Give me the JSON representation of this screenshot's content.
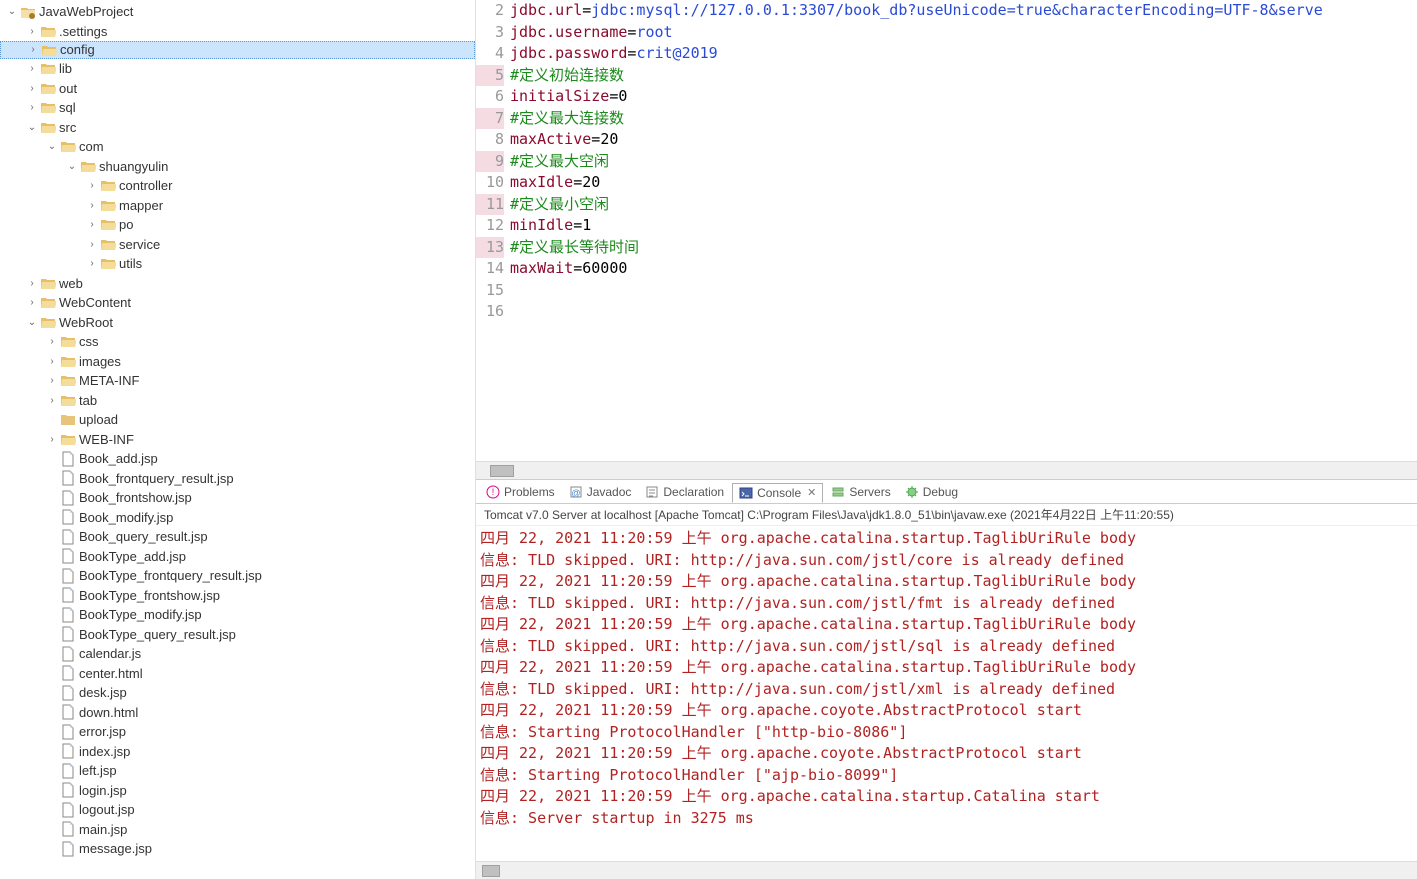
{
  "tree": {
    "root": "JavaWebProject",
    "items": [
      {
        "depth": 0,
        "arrow": "v",
        "icon": "project",
        "label": "JavaWebProject"
      },
      {
        "depth": 1,
        "arrow": ">",
        "icon": "folder-open",
        "label": ".settings"
      },
      {
        "depth": 1,
        "arrow": ">",
        "icon": "folder-open",
        "label": "config",
        "selected": true
      },
      {
        "depth": 1,
        "arrow": ">",
        "icon": "folder-open",
        "label": "lib"
      },
      {
        "depth": 1,
        "arrow": ">",
        "icon": "folder-open",
        "label": "out"
      },
      {
        "depth": 1,
        "arrow": ">",
        "icon": "folder-open",
        "label": "sql"
      },
      {
        "depth": 1,
        "arrow": "v",
        "icon": "folder-open",
        "label": "src"
      },
      {
        "depth": 2,
        "arrow": "v",
        "icon": "folder-open",
        "label": "com"
      },
      {
        "depth": 3,
        "arrow": "v",
        "icon": "folder-open",
        "label": "shuangyulin"
      },
      {
        "depth": 4,
        "arrow": ">",
        "icon": "folder-open",
        "label": "controller"
      },
      {
        "depth": 4,
        "arrow": ">",
        "icon": "folder-open",
        "label": "mapper"
      },
      {
        "depth": 4,
        "arrow": ">",
        "icon": "folder-open",
        "label": "po"
      },
      {
        "depth": 4,
        "arrow": ">",
        "icon": "folder-open",
        "label": "service"
      },
      {
        "depth": 4,
        "arrow": ">",
        "icon": "folder-open",
        "label": "utils"
      },
      {
        "depth": 1,
        "arrow": ">",
        "icon": "folder-open",
        "label": "web"
      },
      {
        "depth": 1,
        "arrow": ">",
        "icon": "folder-open",
        "label": "WebContent"
      },
      {
        "depth": 1,
        "arrow": "v",
        "icon": "folder-open",
        "label": "WebRoot"
      },
      {
        "depth": 2,
        "arrow": ">",
        "icon": "folder-open",
        "label": "css"
      },
      {
        "depth": 2,
        "arrow": ">",
        "icon": "folder-open",
        "label": "images"
      },
      {
        "depth": 2,
        "arrow": ">",
        "icon": "folder-open",
        "label": "META-INF"
      },
      {
        "depth": 2,
        "arrow": ">",
        "icon": "folder-open",
        "label": "tab"
      },
      {
        "depth": 2,
        "arrow": "",
        "icon": "folder-closed",
        "label": "upload"
      },
      {
        "depth": 2,
        "arrow": ">",
        "icon": "folder-open",
        "label": "WEB-INF"
      },
      {
        "depth": 2,
        "arrow": "",
        "icon": "file",
        "label": "Book_add.jsp"
      },
      {
        "depth": 2,
        "arrow": "",
        "icon": "file",
        "label": "Book_frontquery_result.jsp"
      },
      {
        "depth": 2,
        "arrow": "",
        "icon": "file",
        "label": "Book_frontshow.jsp"
      },
      {
        "depth": 2,
        "arrow": "",
        "icon": "file",
        "label": "Book_modify.jsp"
      },
      {
        "depth": 2,
        "arrow": "",
        "icon": "file",
        "label": "Book_query_result.jsp"
      },
      {
        "depth": 2,
        "arrow": "",
        "icon": "file",
        "label": "BookType_add.jsp"
      },
      {
        "depth": 2,
        "arrow": "",
        "icon": "file",
        "label": "BookType_frontquery_result.jsp"
      },
      {
        "depth": 2,
        "arrow": "",
        "icon": "file",
        "label": "BookType_frontshow.jsp"
      },
      {
        "depth": 2,
        "arrow": "",
        "icon": "file",
        "label": "BookType_modify.jsp"
      },
      {
        "depth": 2,
        "arrow": "",
        "icon": "file",
        "label": "BookType_query_result.jsp"
      },
      {
        "depth": 2,
        "arrow": "",
        "icon": "file",
        "label": "calendar.js"
      },
      {
        "depth": 2,
        "arrow": "",
        "icon": "file",
        "label": "center.html"
      },
      {
        "depth": 2,
        "arrow": "",
        "icon": "file",
        "label": "desk.jsp"
      },
      {
        "depth": 2,
        "arrow": "",
        "icon": "file",
        "label": "down.html"
      },
      {
        "depth": 2,
        "arrow": "",
        "icon": "file",
        "label": "error.jsp"
      },
      {
        "depth": 2,
        "arrow": "",
        "icon": "file",
        "label": "index.jsp"
      },
      {
        "depth": 2,
        "arrow": "",
        "icon": "file",
        "label": "left.jsp"
      },
      {
        "depth": 2,
        "arrow": "",
        "icon": "file",
        "label": "login.jsp"
      },
      {
        "depth": 2,
        "arrow": "",
        "icon": "file",
        "label": "logout.jsp"
      },
      {
        "depth": 2,
        "arrow": "",
        "icon": "file",
        "label": "main.jsp"
      },
      {
        "depth": 2,
        "arrow": "",
        "icon": "file",
        "label": "message.jsp"
      }
    ]
  },
  "editor": {
    "lines": [
      {
        "n": 2,
        "hl": false,
        "tokens": [
          [
            "key",
            "jdbc.url"
          ],
          [
            "eq",
            "="
          ],
          [
            "url",
            "jdbc:mysql://127.0.0.1:3307/book_db?useUnicode=true&characterEncoding=UTF-8&serve"
          ]
        ]
      },
      {
        "n": 3,
        "hl": false,
        "tokens": [
          [
            "key",
            "jdbc.username"
          ],
          [
            "eq",
            "="
          ],
          [
            "str",
            "root"
          ]
        ]
      },
      {
        "n": 4,
        "hl": false,
        "tokens": [
          [
            "key",
            "jdbc.password"
          ],
          [
            "eq",
            "="
          ],
          [
            "str",
            "crit@2019"
          ]
        ]
      },
      {
        "n": 5,
        "hl": true,
        "tokens": [
          [
            "comment",
            "#定义初始连接数"
          ]
        ]
      },
      {
        "n": 6,
        "hl": false,
        "tokens": [
          [
            "key",
            "initialSize"
          ],
          [
            "eq",
            "="
          ],
          [
            "num",
            "0"
          ]
        ]
      },
      {
        "n": 7,
        "hl": true,
        "tokens": [
          [
            "comment",
            "#定义最大连接数"
          ]
        ]
      },
      {
        "n": 8,
        "hl": false,
        "tokens": [
          [
            "key",
            "maxActive"
          ],
          [
            "eq",
            "="
          ],
          [
            "num",
            "20"
          ]
        ]
      },
      {
        "n": 9,
        "hl": true,
        "tokens": [
          [
            "comment",
            "#定义最大空闲"
          ]
        ]
      },
      {
        "n": 10,
        "hl": false,
        "tokens": [
          [
            "key",
            "maxIdle"
          ],
          [
            "eq",
            "="
          ],
          [
            "num",
            "20"
          ]
        ]
      },
      {
        "n": 11,
        "hl": true,
        "tokens": [
          [
            "comment",
            "#定义最小空闲"
          ]
        ]
      },
      {
        "n": 12,
        "hl": false,
        "tokens": [
          [
            "key",
            "minIdle"
          ],
          [
            "eq",
            "="
          ],
          [
            "num",
            "1"
          ]
        ]
      },
      {
        "n": 13,
        "hl": true,
        "tokens": [
          [
            "comment",
            "#定义最长等待时间"
          ]
        ]
      },
      {
        "n": 14,
        "hl": false,
        "tokens": [
          [
            "key",
            "maxWait"
          ],
          [
            "eq",
            "="
          ],
          [
            "num",
            "60000"
          ]
        ]
      },
      {
        "n": 15,
        "hl": false,
        "tokens": []
      },
      {
        "n": 16,
        "hl": false,
        "tokens": []
      }
    ]
  },
  "tabs": [
    {
      "label": "Problems",
      "icon": "problems",
      "active": false
    },
    {
      "label": "Javadoc",
      "icon": "javadoc",
      "active": false
    },
    {
      "label": "Declaration",
      "icon": "declaration",
      "active": false
    },
    {
      "label": "Console",
      "icon": "console",
      "active": true,
      "closable": true
    },
    {
      "label": "Servers",
      "icon": "servers",
      "active": false
    },
    {
      "label": "Debug",
      "icon": "debug",
      "active": false
    }
  ],
  "console": {
    "header": "Tomcat v7.0 Server at localhost [Apache Tomcat] C:\\Program Files\\Java\\jdk1.8.0_51\\bin\\javaw.exe (2021年4月22日 上午11:20:55)",
    "lines": [
      "四月 22, 2021 11:20:59 上午 org.apache.catalina.startup.TaglibUriRule body",
      "信息: TLD skipped. URI: http://java.sun.com/jstl/core is already defined",
      "四月 22, 2021 11:20:59 上午 org.apache.catalina.startup.TaglibUriRule body",
      "信息: TLD skipped. URI: http://java.sun.com/jstl/fmt is already defined",
      "四月 22, 2021 11:20:59 上午 org.apache.catalina.startup.TaglibUriRule body",
      "信息: TLD skipped. URI: http://java.sun.com/jstl/sql is already defined",
      "四月 22, 2021 11:20:59 上午 org.apache.catalina.startup.TaglibUriRule body",
      "信息: TLD skipped. URI: http://java.sun.com/jstl/xml is already defined",
      "四月 22, 2021 11:20:59 上午 org.apache.coyote.AbstractProtocol start",
      "信息: Starting ProtocolHandler [\"http-bio-8086\"]",
      "四月 22, 2021 11:20:59 上午 org.apache.coyote.AbstractProtocol start",
      "信息: Starting ProtocolHandler [\"ajp-bio-8099\"]",
      "四月 22, 2021 11:20:59 上午 org.apache.catalina.startup.Catalina start",
      "信息: Server startup in 3275 ms"
    ]
  }
}
